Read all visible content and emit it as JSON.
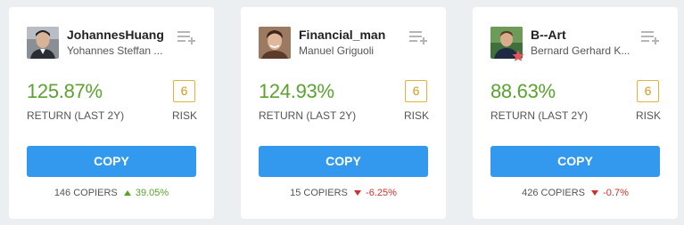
{
  "colors": {
    "accent": "#3399ee",
    "positive": "#5aa32f",
    "negative": "#d0312d",
    "risk": "#d29a18"
  },
  "cards": [
    {
      "username": "JohannesHuang",
      "full_name": "Yohannes Steffan ...",
      "avatar_icon": "user-photo",
      "watchlist_icon": "add-to-watchlist-icon",
      "return_value": "125.87%",
      "return_label": "RETURN (LAST 2Y)",
      "risk_score": "6",
      "risk_label": "RISK",
      "copy_label": "COPY",
      "copiers": "146 COPIERS",
      "change": "39.05%",
      "change_direction": "up"
    },
    {
      "username": "Financial_man",
      "full_name": "Manuel Griguoli",
      "avatar_icon": "user-photo",
      "watchlist_icon": "add-to-watchlist-icon",
      "return_value": "124.93%",
      "return_label": "RETURN (LAST 2Y)",
      "risk_score": "6",
      "risk_label": "RISK",
      "copy_label": "COPY",
      "copiers": "15 COPIERS",
      "change": "-6.25%",
      "change_direction": "down"
    },
    {
      "username": "B--Art",
      "full_name": "Bernard Gerhard K...",
      "avatar_icon": "user-photo",
      "badge_icon": "star-icon",
      "watchlist_icon": "add-to-watchlist-icon",
      "return_value": "88.63%",
      "return_label": "RETURN (LAST 2Y)",
      "risk_score": "6",
      "risk_label": "RISK",
      "copy_label": "COPY",
      "copiers": "426 COPIERS",
      "change": "-0.7%",
      "change_direction": "down"
    }
  ]
}
